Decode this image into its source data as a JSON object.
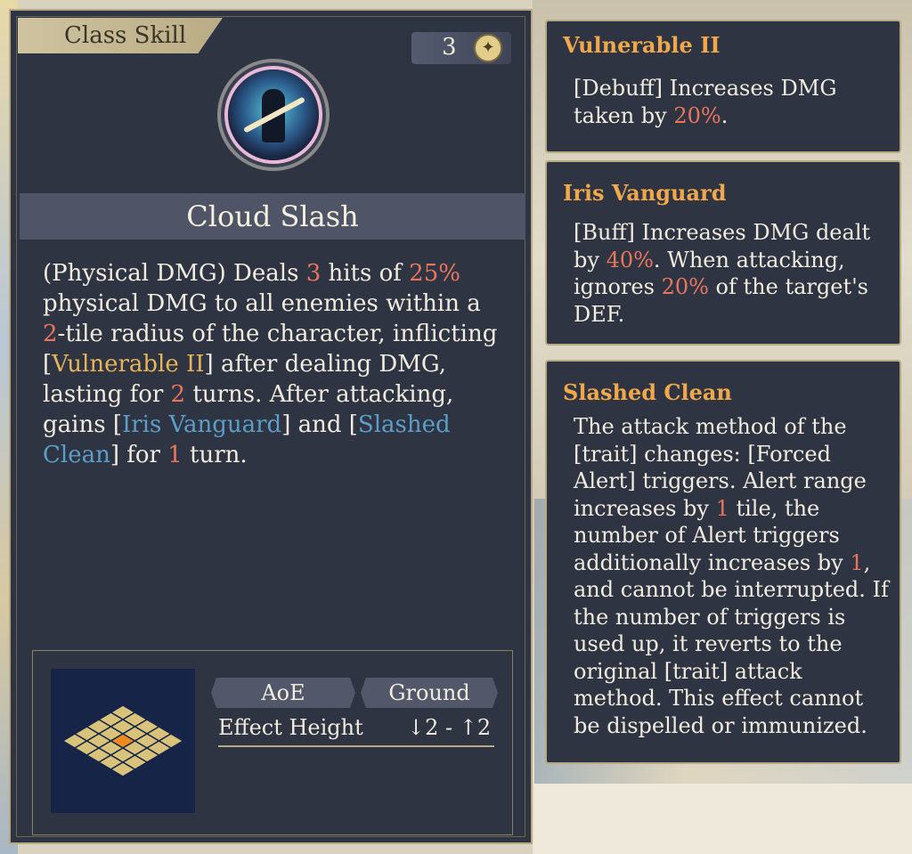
{
  "class_tag": "Class Skill",
  "cost": {
    "value": "3",
    "icon": "star-coin-icon"
  },
  "skill": {
    "name": "Cloud Slash",
    "description_parts": [
      {
        "t": "(Physical DMG) Deals ",
        "c": "plain"
      },
      {
        "t": "3",
        "c": "num"
      },
      {
        "t": " hits of ",
        "c": "plain"
      },
      {
        "t": "25%",
        "c": "num"
      },
      {
        "t": " physical DMG to all enemies within a ",
        "c": "plain"
      },
      {
        "t": "2",
        "c": "num"
      },
      {
        "t": "-tile radius of the character, inflicting [",
        "c": "plain"
      },
      {
        "t": "Vulnerable II",
        "c": "gold"
      },
      {
        "t": "] after dealing DMG, lasting for ",
        "c": "plain"
      },
      {
        "t": "2",
        "c": "num"
      },
      {
        "t": " turns. After attacking, gains [",
        "c": "plain"
      },
      {
        "t": "Iris Vanguard",
        "c": "blue"
      },
      {
        "t": "] and [",
        "c": "plain"
      },
      {
        "t": "Slashed Clean",
        "c": "blue"
      },
      {
        "t": "] for ",
        "c": "plain"
      },
      {
        "t": "1",
        "c": "num"
      },
      {
        "t": " turn.",
        "c": "plain"
      }
    ]
  },
  "range": {
    "shape_label": "AoE",
    "terrain_label": "Ground",
    "height_label": "Effect Height",
    "height_value": "↓2 - ↑2"
  },
  "tooltips": [
    {
      "title": "Vulnerable II",
      "parts": [
        {
          "t": "[Debuff] Increases DMG taken by ",
          "c": "plain"
        },
        {
          "t": "20%",
          "c": "num"
        },
        {
          "t": ".",
          "c": "plain"
        }
      ]
    },
    {
      "title": "Iris Vanguard",
      "parts": [
        {
          "t": "[Buff] Increases DMG dealt by ",
          "c": "plain"
        },
        {
          "t": "40%",
          "c": "num"
        },
        {
          "t": ". When attacking, ignores ",
          "c": "plain"
        },
        {
          "t": "20%",
          "c": "num"
        },
        {
          "t": " of the target's DEF.",
          "c": "plain"
        }
      ]
    },
    {
      "title": "Slashed Clean",
      "parts": [
        {
          "t": "The attack method of the [trait] changes: [Forced Alert] triggers. Alert range increases by ",
          "c": "plain"
        },
        {
          "t": "1",
          "c": "num"
        },
        {
          "t": " tile, the number of Alert triggers additionally increases by ",
          "c": "plain"
        },
        {
          "t": "1",
          "c": "num"
        },
        {
          "t": ", and cannot be interrupted. If the number of triggers is used up, it reverts to the original [trait] attack method. This effect cannot be dispelled or immunized.",
          "c": "plain"
        }
      ]
    }
  ],
  "colors": {
    "number": "#e9765c",
    "gold": "#e8b45a",
    "blue": "#5b9ec8",
    "title": "#f0a84a"
  }
}
